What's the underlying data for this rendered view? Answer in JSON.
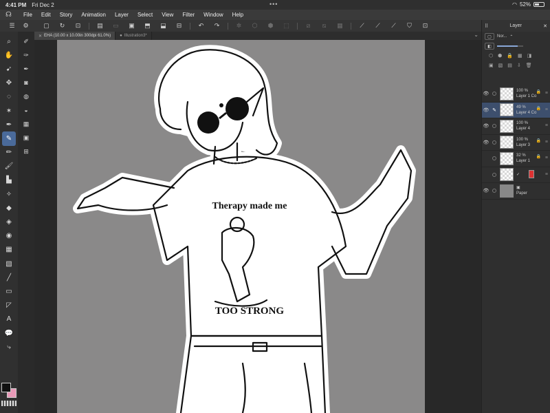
{
  "status": {
    "time": "4:41 PM",
    "date": "Fri Dec 2",
    "battery": "52%",
    "battery_level": 0.52
  },
  "menu": [
    "File",
    "Edit",
    "Story",
    "Animation",
    "Layer",
    "Select",
    "View",
    "Filter",
    "Window",
    "Help"
  ],
  "tabs": [
    {
      "label": "EHA (10.00 x 10.00in 300dpi 61.0%)",
      "active": true
    },
    {
      "label": "Illustration3*",
      "active": false
    }
  ],
  "layer_panel": {
    "title": "Layer",
    "blend_mode": "Nor..."
  },
  "layers": [
    {
      "opacity": "100 %",
      "name": "Layer 1 Co",
      "selected": false,
      "visible": true,
      "locked": true
    },
    {
      "opacity": "49 %",
      "name": "Layer 4 Co",
      "selected": true,
      "visible": true,
      "locked": true,
      "editing": true
    },
    {
      "opacity": "100 %",
      "name": "Layer 4",
      "selected": false,
      "visible": true,
      "locked": false
    },
    {
      "opacity": "100 %",
      "name": "Layer 3",
      "selected": false,
      "visible": true,
      "locked": true
    },
    {
      "opacity": "32 %",
      "name": "Layer 1",
      "selected": false,
      "visible": false,
      "locked": true
    },
    {
      "opacity": "",
      "name": "",
      "selected": false,
      "visible": false,
      "locked": false,
      "folder": true
    },
    {
      "opacity": "",
      "name": "Paper",
      "selected": false,
      "visible": true,
      "locked": false,
      "paper": true
    }
  ],
  "artwork": {
    "shirt_line1": "Therapy made me",
    "shirt_line2": "TOO STRONG"
  },
  "colors": {
    "canvas_bg": "#8a8989",
    "accent": "#4a6a9a",
    "main_color": "#111111",
    "sub_color": "#e89ab8"
  }
}
